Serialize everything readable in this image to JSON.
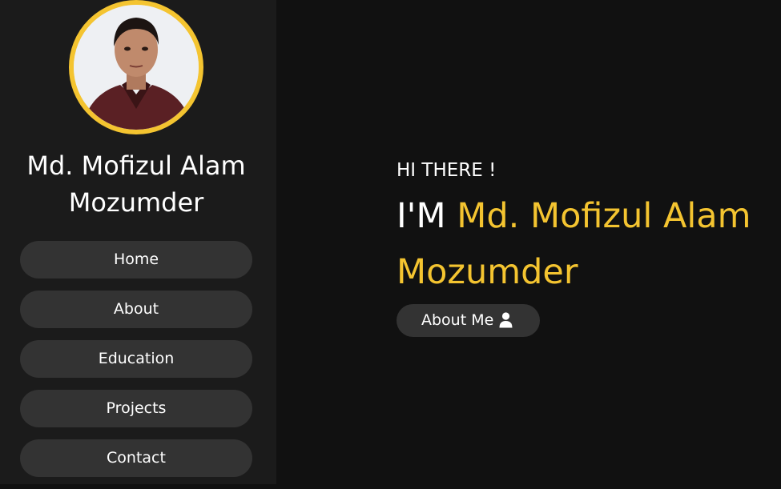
{
  "sidebar": {
    "name": "Md. Mofizul Alam Mozumder",
    "nav": [
      {
        "label": "Home"
      },
      {
        "label": "About"
      },
      {
        "label": "Education"
      },
      {
        "label": "Projects"
      },
      {
        "label": "Contact"
      }
    ]
  },
  "hero": {
    "greeting": "HI THERE !",
    "prefix": "I'M",
    "name": "Md. Mofizul Alam Mozumder",
    "button_label": "About Me",
    "button_icon": "user-icon"
  },
  "colors": {
    "accent": "#f4c430",
    "sidebar_bg": "#1b1b1b",
    "main_bg": "#111111",
    "button_bg": "#333333"
  }
}
